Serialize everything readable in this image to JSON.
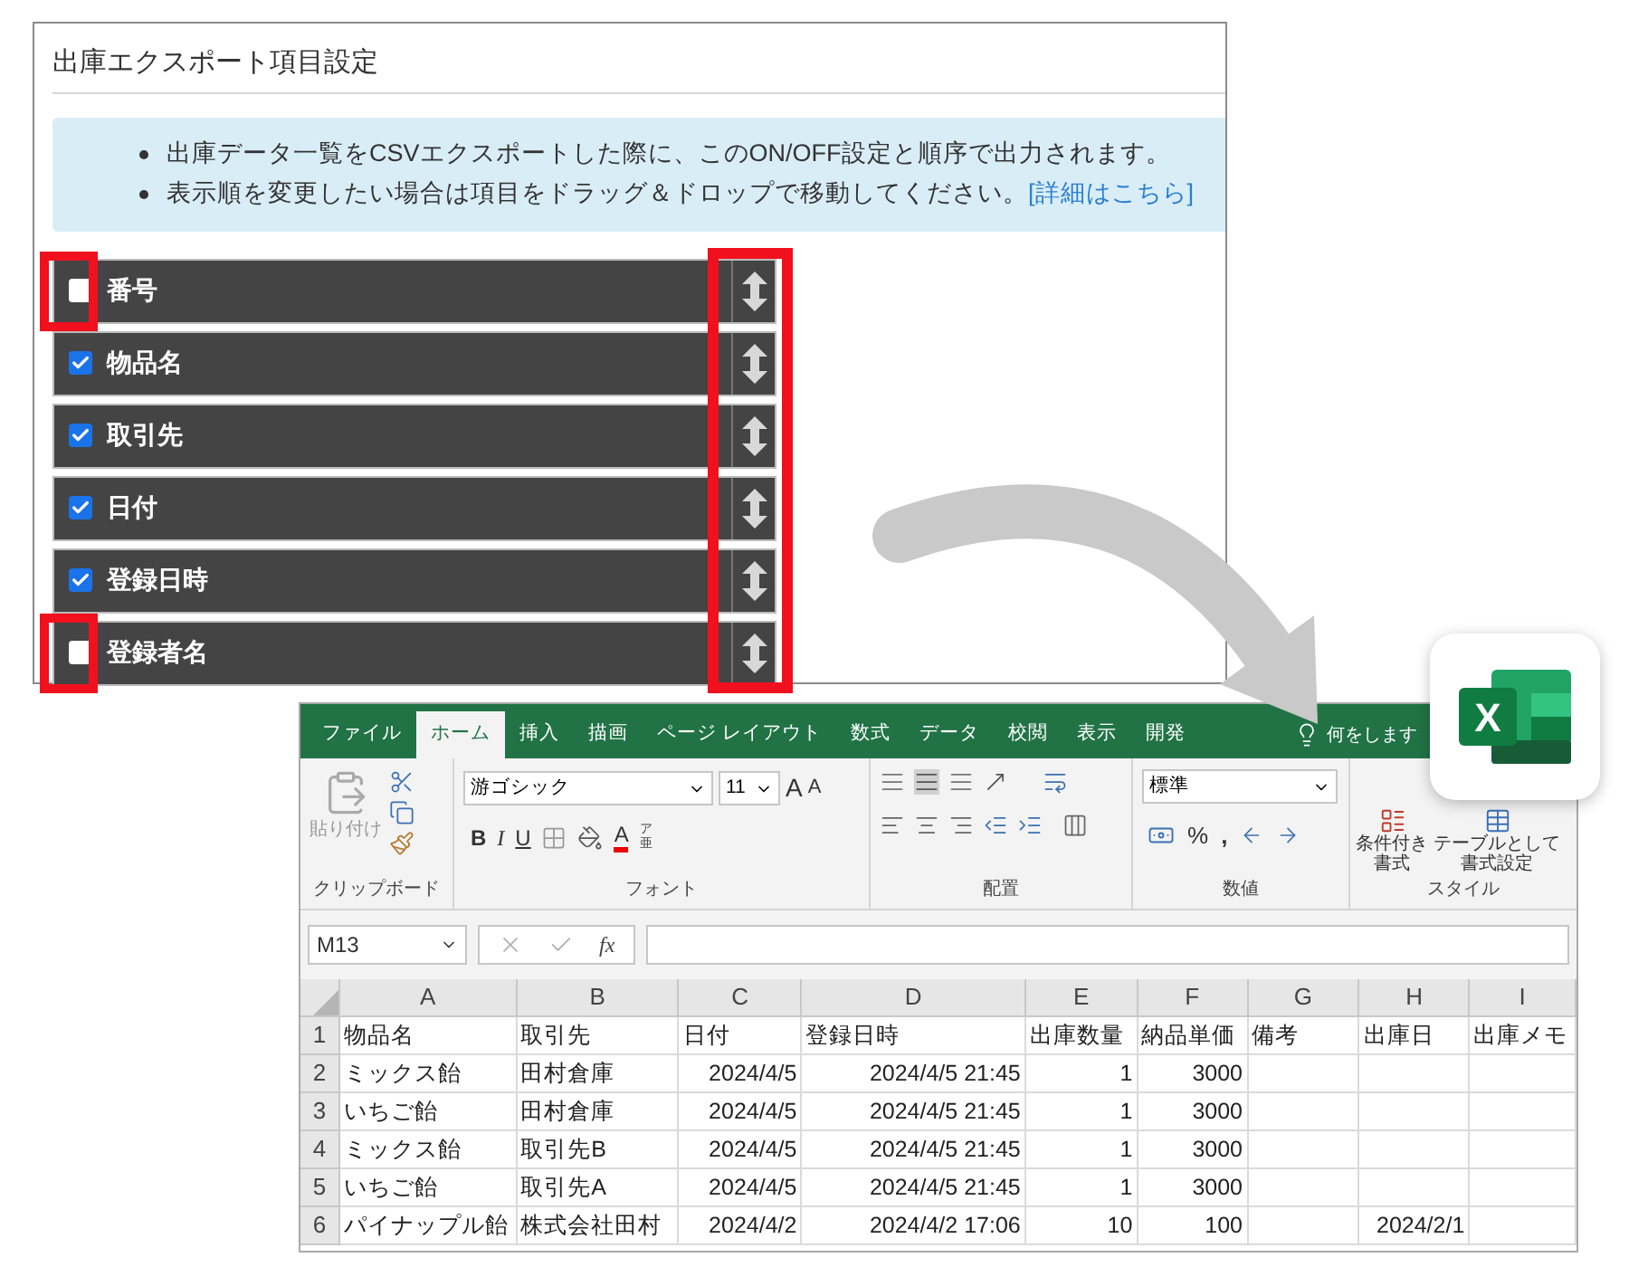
{
  "settings_panel": {
    "title": "出庫エクスポート項目設定",
    "notes": [
      {
        "text": "出庫データ一覧をCSVエクスポートした際に、このON/OFF設定と順序で出力されます。"
      },
      {
        "text": "表示順を変更したい場合は項目をドラッグ＆ドロップで移動してください。",
        "link": "[詳細はこちら]"
      }
    ],
    "fields": [
      {
        "label": "番号",
        "checked": false,
        "highlighted": true
      },
      {
        "label": "物品名",
        "checked": true,
        "highlighted": false
      },
      {
        "label": "取引先",
        "checked": true,
        "highlighted": false
      },
      {
        "label": "日付",
        "checked": true,
        "highlighted": false
      },
      {
        "label": "登録日時",
        "checked": true,
        "highlighted": false
      },
      {
        "label": "登録者名",
        "checked": false,
        "highlighted": true
      }
    ],
    "handles_highlighted": true
  },
  "excel": {
    "tabs": [
      {
        "label": "ファイル",
        "selected": false
      },
      {
        "label": "ホーム",
        "selected": true
      },
      {
        "label": "挿入",
        "selected": false
      },
      {
        "label": "描画",
        "selected": false
      },
      {
        "label": "ページ レイアウト",
        "selected": false
      },
      {
        "label": "数式",
        "selected": false
      },
      {
        "label": "データ",
        "selected": false
      },
      {
        "label": "校閲",
        "selected": false
      },
      {
        "label": "表示",
        "selected": false
      },
      {
        "label": "開発",
        "selected": false
      }
    ],
    "tell_me": "何をします",
    "ribbon": {
      "clipboard": {
        "paste": "貼り付け",
        "label": "クリップボード"
      },
      "font": {
        "name": "游ゴシック",
        "size": "11",
        "grow": "A",
        "shrink": "A",
        "styles": [
          "B",
          "I",
          "U"
        ],
        "color_button": "A",
        "phonetic": [
          "ア",
          "亜"
        ],
        "label": "フォント"
      },
      "alignment": {
        "label": "配置"
      },
      "number": {
        "format": "標準",
        "percent": "%",
        "comma": ",",
        "label": "数値"
      },
      "styles": {
        "conditional": [
          "条件付き",
          "書式"
        ],
        "table": [
          "テーブルとして",
          "書式設定"
        ],
        "label": "スタイル"
      }
    },
    "name_box": "M13",
    "fx": "fx",
    "columns": [
      {
        "label": "A",
        "kind": "text"
      },
      {
        "label": "B",
        "kind": "text"
      },
      {
        "label": "C",
        "kind": "number"
      },
      {
        "label": "D",
        "kind": "number"
      },
      {
        "label": "E",
        "kind": "number"
      },
      {
        "label": "F",
        "kind": "number"
      },
      {
        "label": "G",
        "kind": "text"
      },
      {
        "label": "H",
        "kind": "number"
      },
      {
        "label": "I",
        "kind": "text"
      }
    ],
    "rows": [
      {
        "number": "1",
        "kind": "header",
        "cells": [
          "物品名",
          "取引先",
          "日付",
          "登録日時",
          "出庫数量",
          "納品単価",
          "備考",
          "出庫日",
          "出庫メモ"
        ]
      },
      {
        "number": "2",
        "kind": "record",
        "cells": [
          "ミックス飴",
          "田村倉庫",
          "2024/4/5",
          "2024/4/5 21:45",
          "1",
          "3000",
          "",
          "",
          ""
        ]
      },
      {
        "number": "3",
        "kind": "record",
        "cells": [
          "いちご飴",
          "田村倉庫",
          "2024/4/5",
          "2024/4/5 21:45",
          "1",
          "3000",
          "",
          "",
          ""
        ]
      },
      {
        "number": "4",
        "kind": "record",
        "cells": [
          "ミックス飴",
          "取引先B",
          "2024/4/5",
          "2024/4/5 21:45",
          "1",
          "3000",
          "",
          "",
          ""
        ]
      },
      {
        "number": "5",
        "kind": "record",
        "cells": [
          "いちご飴",
          "取引先A",
          "2024/4/5",
          "2024/4/5 21:45",
          "1",
          "3000",
          "",
          "",
          ""
        ]
      },
      {
        "number": "6",
        "kind": "record",
        "cells": [
          "パイナップル飴",
          "株式会社田村",
          "2024/4/2",
          "2024/4/2 17:06",
          "10",
          "100",
          "",
          "2024/2/1",
          ""
        ]
      }
    ]
  },
  "app_icon": {
    "letter": "X"
  }
}
